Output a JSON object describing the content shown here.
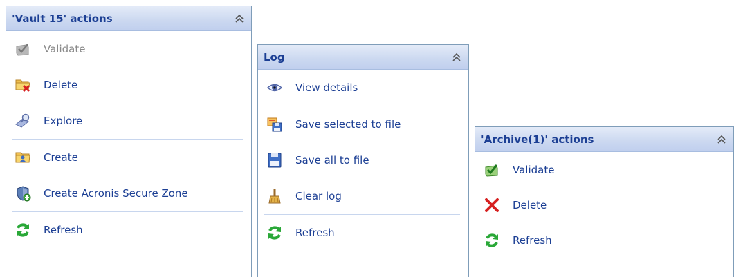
{
  "vault_panel": {
    "title": "'Vault 15' actions",
    "items": [
      {
        "label": "Validate",
        "icon": "validate-icon",
        "enabled": false
      },
      {
        "label": "Delete",
        "icon": "folder-delete-icon",
        "enabled": true
      },
      {
        "label": "Explore",
        "icon": "explore-icon",
        "enabled": true
      },
      {
        "label": "Create",
        "icon": "folder-create-icon",
        "enabled": true
      },
      {
        "label": "Create Acronis Secure Zone",
        "icon": "secure-zone-icon",
        "enabled": true
      },
      {
        "label": "Refresh",
        "icon": "refresh-icon",
        "enabled": true
      }
    ]
  },
  "log_panel": {
    "title": "Log",
    "items": [
      {
        "label": "View details",
        "icon": "eye-icon"
      },
      {
        "label": "Save selected to file",
        "icon": "save-selected-icon"
      },
      {
        "label": "Save all to file",
        "icon": "floppy-disk-icon"
      },
      {
        "label": "Clear log",
        "icon": "broom-icon"
      },
      {
        "label": "Refresh",
        "icon": "refresh-icon"
      }
    ]
  },
  "archive_panel": {
    "title": "'Archive(1)' actions",
    "items": [
      {
        "label": "Validate",
        "icon": "checkmark-icon"
      },
      {
        "label": "Delete",
        "icon": "red-x-icon"
      },
      {
        "label": "Refresh",
        "icon": "refresh-icon"
      }
    ]
  },
  "colors": {
    "title_text": "#1c3f94",
    "link_text": "#1c3f94",
    "disabled_text": "#8a8a8a",
    "header_bg": "#cbd8f0",
    "border": "#7f9db9",
    "refresh_green": "#2aa838"
  }
}
